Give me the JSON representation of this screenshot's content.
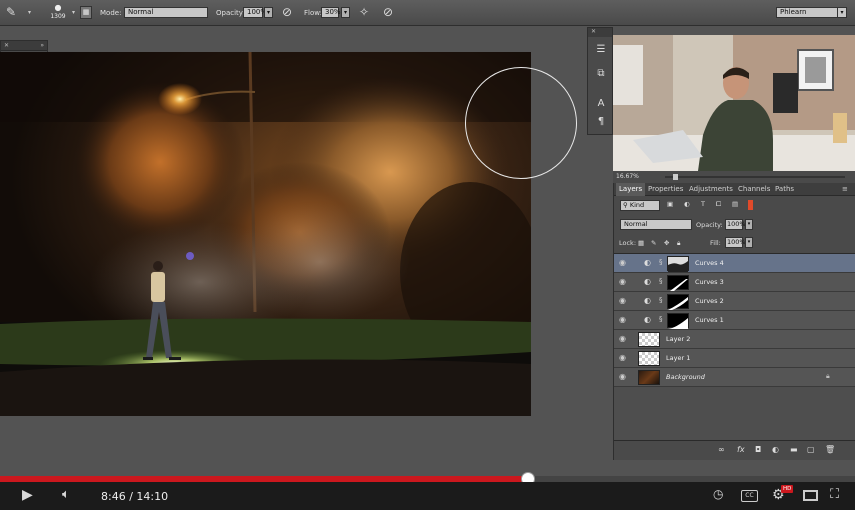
{
  "options_bar": {
    "brush_size": "1309",
    "mode_label": "Mode:",
    "mode_value": "Normal",
    "opacity_label": "Opacity:",
    "opacity_value": "100%",
    "flow_label": "Flow:",
    "flow_value": "30%",
    "workspace": "Phlearn"
  },
  "navigator": {
    "zoom": "16.67%"
  },
  "layers_panel": {
    "tabs": [
      "Layers",
      "Properties",
      "Adjustments",
      "Channels",
      "Paths"
    ],
    "filter_kind": "Kind",
    "blend_mode": "Normal",
    "opacity_label": "Opacity:",
    "opacity_value": "100%",
    "lock_label": "Lock:",
    "fill_label": "Fill:",
    "fill_value": "100%",
    "layers": [
      {
        "name": "Curves 4",
        "selected": true
      },
      {
        "name": "Curves 3",
        "selected": false
      },
      {
        "name": "Curves 2",
        "selected": false
      },
      {
        "name": "Curves 1",
        "selected": false
      },
      {
        "name": "Layer 2",
        "selected": false
      },
      {
        "name": "Layer 1",
        "selected": false
      },
      {
        "name": "Background",
        "selected": false
      }
    ]
  },
  "video": {
    "current_time": "8:46",
    "duration": "14:10",
    "time_display": "8:46 / 14:10",
    "progress_fraction": 0.618,
    "hd_badge": "HD",
    "cc_label": "CC"
  },
  "colors": {
    "progress_red": "#cc181e",
    "panel_bg": "#4a4a4a",
    "selected_layer": "#66738a"
  }
}
